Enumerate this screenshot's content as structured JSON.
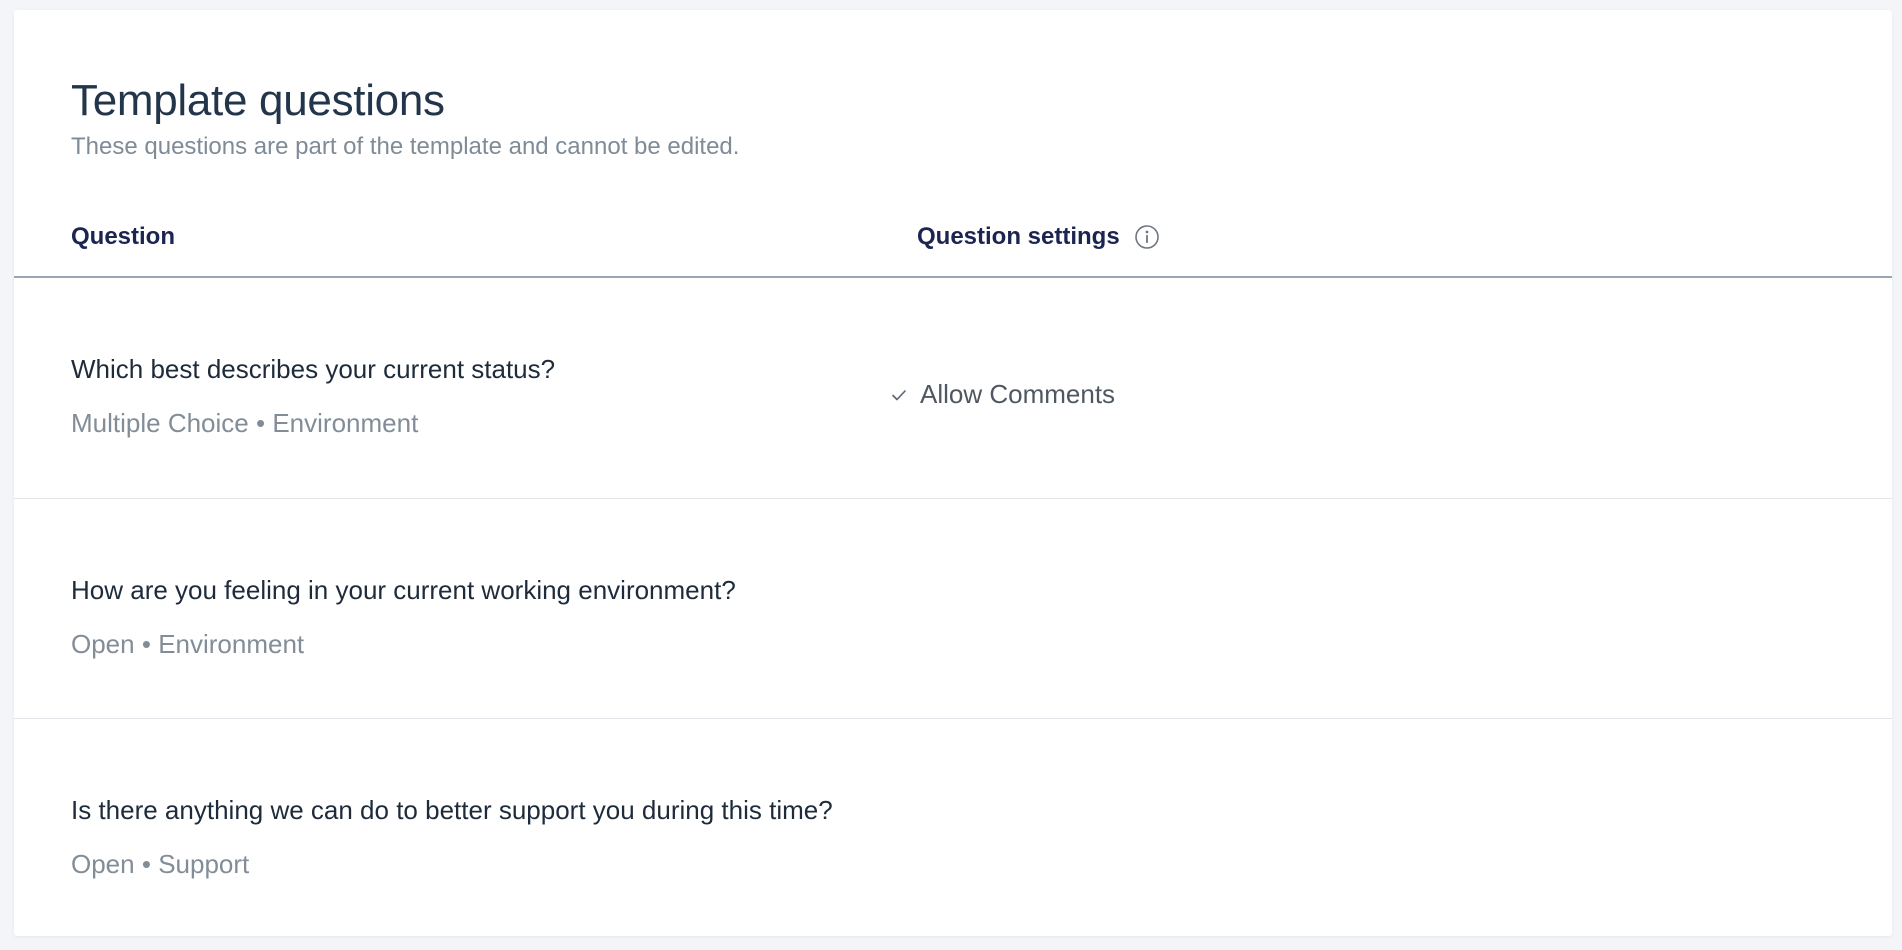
{
  "section": {
    "title": "Template questions",
    "subtitle": "These questions are part of the template and cannot be edited."
  },
  "columns": {
    "question": "Question",
    "settings": "Question settings"
  },
  "icons": {
    "info": "info-icon",
    "check": "check-icon"
  },
  "questions": [
    {
      "text": "Which best describes your current status?",
      "type": "Multiple Choice",
      "separator": "•",
      "category": "Environment",
      "settings": [
        "Allow Comments"
      ]
    },
    {
      "text": "How are you feeling in your current working environment?",
      "type": "Open",
      "separator": "•",
      "category": "Environment",
      "settings": []
    },
    {
      "text": "Is there anything we can do to better support you during this time?",
      "type": "Open",
      "separator": "•",
      "category": "Support",
      "settings": []
    }
  ]
}
